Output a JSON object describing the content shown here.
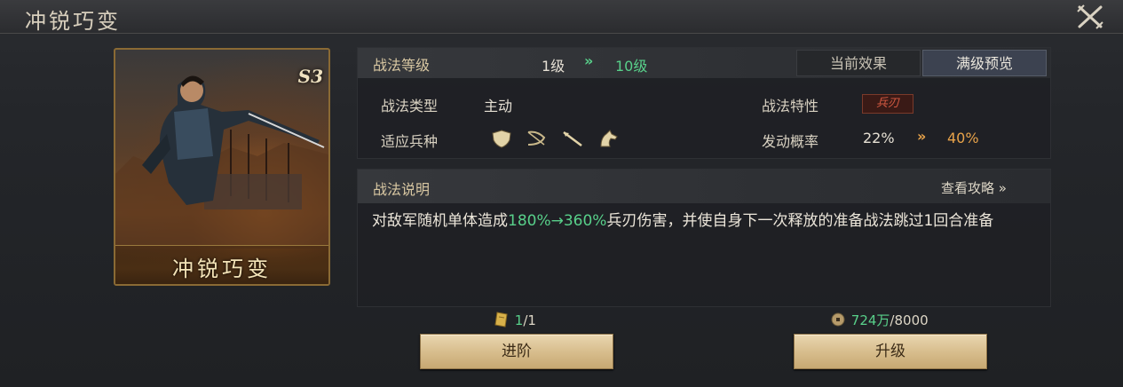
{
  "header": {
    "title": "冲锐巧变"
  },
  "card": {
    "badge": "S3",
    "name": "冲锐巧变"
  },
  "level": {
    "label": "战法等级",
    "current": "1级",
    "arrow": "»",
    "max": "10级"
  },
  "tabs": {
    "current_effect": "当前效果",
    "max_preview": "满级预览"
  },
  "skill_type": {
    "label": "战法类型",
    "value": "主动"
  },
  "skill_trait": {
    "label": "战法特性",
    "value": "兵刃"
  },
  "troops": {
    "label": "适应兵种",
    "icons": [
      "shield-icon",
      "bow-icon",
      "spear-icon",
      "horse-icon"
    ]
  },
  "trigger": {
    "label": "发动概率",
    "current": "22%",
    "arrow": "»",
    "max": "40%"
  },
  "description": {
    "label": "战法说明",
    "guide_link": "查看攻略 »",
    "text_before": "对敌军随机单体造成",
    "text_highlight": "180%→360%",
    "text_after": "兵刃伤害，并使自身下一次释放的准备战法跳过1回合准备"
  },
  "advance": {
    "count_current": "1",
    "count_sep": "/1",
    "button": "进阶"
  },
  "upgrade": {
    "cost": "724万",
    "cost_total": "/8000",
    "button": "升级"
  },
  "colors": {
    "accent_green": "#58d08a",
    "accent_orange": "#e8a34a",
    "button_gold": "#d8be8e"
  }
}
